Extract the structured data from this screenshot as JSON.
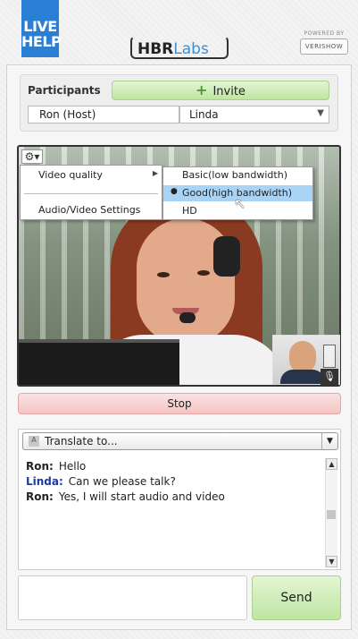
{
  "header": {
    "logo_line1": "LIVE",
    "logo_line2": "HELP",
    "hbr_bold": "HBR",
    "hbr_light": "Labs",
    "powered_by": "POWERED BY",
    "vendor": "VERISHOW"
  },
  "participants": {
    "label": "Participants",
    "invite_label": "Invite",
    "host": "Ron (Host)",
    "selected": "Linda"
  },
  "video_menu": {
    "items": [
      "Video quality",
      "Audio/Video Settings"
    ],
    "quality_options": [
      "Basic(low bandwidth)",
      "Good(high bandwidth)",
      "HD"
    ],
    "selected_quality": "Good(high bandwidth)"
  },
  "stop_label": "Stop",
  "chat": {
    "translate_label": "Translate to...",
    "messages": [
      {
        "sender": "Ron:",
        "text": "Hello"
      },
      {
        "sender": "Linda:",
        "text": "Can we please talk?"
      },
      {
        "sender": "Ron:",
        "text": "Yes, I will start audio and video"
      }
    ],
    "input_value": "",
    "send_label": "Send"
  }
}
